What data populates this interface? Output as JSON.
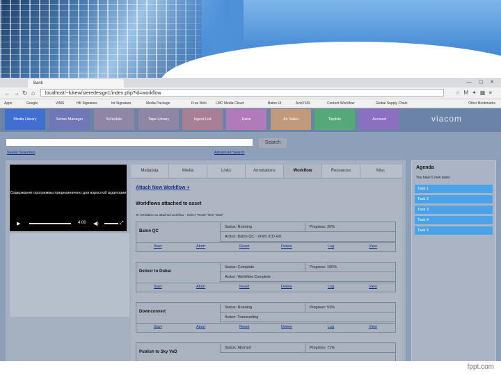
{
  "browser": {
    "tab_title": "Bank",
    "url": "localhost/~lukew/steredesign1/index.php?id=workflow",
    "bookmarks": [
      "Apps",
      "Google",
      "VIMS",
      "HK Signature",
      "Int Signature",
      "Media Package",
      "Free Web",
      "LMC Media Cloud",
      "Baton UI",
      "Avid ISIS",
      "Content Workflow",
      "Global Supply Chain"
    ],
    "other_bookmarks": "Other Bookmarks"
  },
  "app": {
    "nav": [
      "Media Library",
      "Series Manager",
      "Schedule",
      "Tape Library",
      "Ingest List",
      "Extra",
      "Air Sales",
      "Taplists",
      "Account"
    ],
    "nav_colors": [
      "#3f6fd0",
      "#7077b8",
      "#8f86a6",
      "#8f86a6",
      "#a97f95",
      "#b17ab8",
      "#c09a7a",
      "#55a878",
      "#8b70c2"
    ],
    "brand": "viacom",
    "search_button": "Search",
    "saved_searches": "Saved Searches",
    "advanced_search": "Advanced Search",
    "player": {
      "caption": "Содержание программы предназначено для взрослой аудитории",
      "time": "4:00"
    },
    "tabs": [
      "Metadata",
      "Media",
      "Links",
      "Annotations",
      "Workflow",
      "Resources",
      "Misc"
    ],
    "active_tab": "Workflow",
    "attach_link": "Attach New Workflow +",
    "workflows_title": "Workflows attached to asset",
    "workflows_hint": "To reinitialize an attached workflow - Select \"Reset\" then \"Start\"",
    "action_labels": [
      "Start",
      "Abort",
      "Reset",
      "Delete",
      "Log",
      "View"
    ],
    "workflows": [
      {
        "name": "Baton QC",
        "status": "Status: Running",
        "progress": "Progress: 20%",
        "action": "Action: Baton QC - VIMS ICD HD"
      },
      {
        "name": "Deliver to Dubai",
        "status": "Status: Complete",
        "progress": "Progress: 100%",
        "action": "Action: Workflow Complete"
      },
      {
        "name": "Downconvert",
        "status": "Status: Running",
        "progress": "Progress: 53%",
        "action": "Action: Transcoding"
      },
      {
        "name": "Publish to Sky VoD",
        "status": "Status: Aborted",
        "progress": "Progress: 71%",
        "action": ""
      }
    ],
    "agenda": {
      "title": "Agenda",
      "subtitle": "You have 5 new tasks",
      "tasks": [
        "Task 1",
        "Task 2",
        "Task 3",
        "Task 4",
        "Task 5"
      ]
    }
  },
  "footer": {
    "logo": "fppt.com"
  }
}
